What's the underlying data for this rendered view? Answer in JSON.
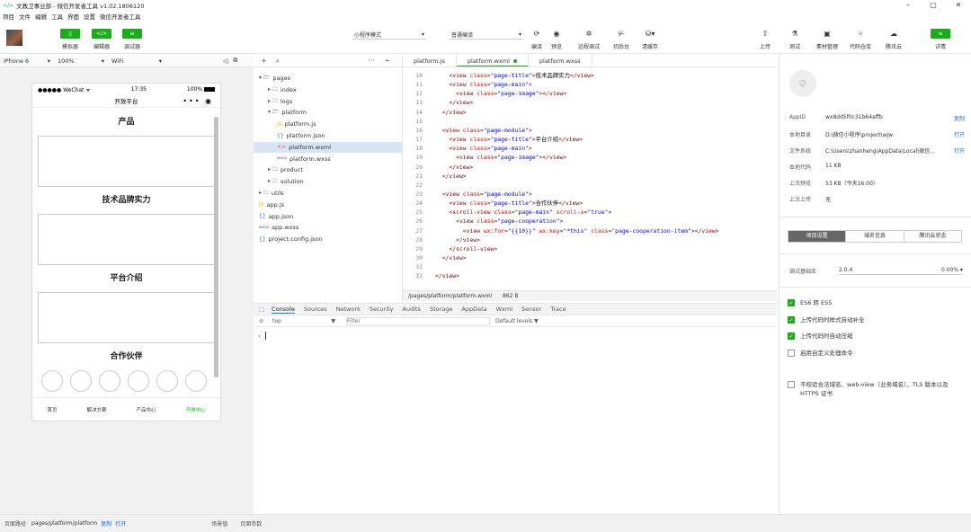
{
  "app": {
    "title": "文教卫事业部 - 微信开发者工具 v1.02.1806120"
  },
  "menu": [
    "项目",
    "文件",
    "编辑",
    "工具",
    "界面",
    "设置",
    "微信开发者工具"
  ],
  "toolbar": {
    "left_buttons": [
      {
        "label": "模拟器",
        "icon": "phone-icon",
        "glyph": "▯"
      },
      {
        "label": "编辑器",
        "icon": "code-icon",
        "glyph": "</>"
      },
      {
        "label": "调试器",
        "icon": "debug-icon",
        "glyph": "≡"
      }
    ],
    "mode_select": "小程序模式",
    "compile_select": "普通编译",
    "center_actions": [
      {
        "label": "编译",
        "glyph": "⟳"
      },
      {
        "label": "预览",
        "glyph": "◉"
      },
      {
        "label": "远程调试",
        "glyph": "✲"
      },
      {
        "label": "切后台",
        "glyph": "⊬"
      },
      {
        "label": "清缓存",
        "glyph": "⛁▾"
      }
    ],
    "right_actions": [
      {
        "label": "上传",
        "glyph": "⇧"
      },
      {
        "label": "测试",
        "glyph": "⚗"
      },
      {
        "label": "素材管理",
        "glyph": "▣"
      },
      {
        "label": "代码仓库",
        "glyph": "⑂"
      },
      {
        "label": "腾讯云",
        "glyph": "☁"
      }
    ],
    "details": {
      "label": "详情",
      "glyph": "≡"
    }
  },
  "device": {
    "model": "iPhone 6",
    "zoom": "100%",
    "network": "WiFi"
  },
  "phone": {
    "carrier": "●●●●● WeChat ᯤ",
    "time": "17:35",
    "battery": "100%",
    "nav_title": "开放平台",
    "capsule": "••• ◉",
    "modules": [
      {
        "title": "产品"
      },
      {
        "title": "技术品牌实力"
      },
      {
        "title": "平台介绍"
      },
      {
        "title": "合作伙伴"
      }
    ],
    "tabs": [
      {
        "label": "首页",
        "active": false
      },
      {
        "label": "解决方案",
        "active": false
      },
      {
        "label": "产品中心",
        "active": false
      },
      {
        "label": "开放中心",
        "active": true
      }
    ]
  },
  "filetree": {
    "items": [
      {
        "label": "pages",
        "indent": 0,
        "ic": "▾ 🗁",
        "icon": "folder-open-icon"
      },
      {
        "label": "index",
        "indent": 1,
        "ic": "▸ 🗀",
        "icon": "folder-icon"
      },
      {
        "label": "logs",
        "indent": 1,
        "ic": "▸ 🗀",
        "icon": "folder-icon"
      },
      {
        "label": "platform",
        "indent": 1,
        "ic": "▾ 🗁",
        "icon": "folder-open-icon"
      },
      {
        "label": "platform.js",
        "indent": 2,
        "ic": "JS",
        "icon": "js-file-icon"
      },
      {
        "label": "platform.json",
        "indent": 2,
        "ic": "{}",
        "icon": "json-file-icon"
      },
      {
        "label": "platform.wxml",
        "indent": 2,
        "ic": "<>",
        "icon": "wxml-file-icon",
        "active": true
      },
      {
        "label": "platform.wxss",
        "indent": 2,
        "ic": "wxss",
        "icon": "wxss-file-icon"
      },
      {
        "label": "product",
        "indent": 1,
        "ic": "▸ 🗀",
        "icon": "folder-icon"
      },
      {
        "label": "solution",
        "indent": 1,
        "ic": "▸ 🗀",
        "icon": "folder-icon"
      },
      {
        "label": "utils",
        "indent": 0,
        "ic": "▸ 🗀",
        "icon": "folder-icon"
      },
      {
        "label": "app.js",
        "indent": 0,
        "ic": "JS",
        "icon": "js-file-icon"
      },
      {
        "label": "app.json",
        "indent": 0,
        "ic": "{}",
        "icon": "json-file-icon"
      },
      {
        "label": "app.wxss",
        "indent": 0,
        "ic": "wxss",
        "icon": "wxss-file-icon"
      },
      {
        "label": "project.config.json",
        "indent": 0,
        "ic": "{}",
        "icon": "json-file-icon"
      }
    ]
  },
  "editor": {
    "tabs": [
      {
        "label": "platform.js",
        "active": false
      },
      {
        "label": "platform.wxml",
        "active": true
      },
      {
        "label": "platform.wxss",
        "active": false
      }
    ],
    "lines": [
      {
        "n": "10",
        "i": "    ",
        "c": "page-title",
        "text": "技术品牌实力",
        "k": "t"
      },
      {
        "n": "11",
        "i": "    ",
        "c": "page-main",
        "k": "o"
      },
      {
        "n": "12",
        "i": "      ",
        "c": "page-image",
        "k": "s"
      },
      {
        "n": "13",
        "i": "    ",
        "k": "e"
      },
      {
        "n": "14",
        "i": "  ",
        "k": "e"
      },
      {
        "n": "15",
        "i": "",
        "k": "b"
      },
      {
        "n": "16",
        "i": "  ",
        "c": "page-module",
        "k": "o"
      },
      {
        "n": "17",
        "i": "    ",
        "c": "page-title",
        "text": "平台介绍",
        "k": "t"
      },
      {
        "n": "18",
        "i": "    ",
        "c": "page-main",
        "k": "o"
      },
      {
        "n": "19",
        "i": "      ",
        "c": "page-image",
        "k": "s"
      },
      {
        "n": "20",
        "i": "    ",
        "k": "e"
      },
      {
        "n": "21",
        "i": "  ",
        "k": "e"
      },
      {
        "n": "22",
        "i": "",
        "k": "b"
      },
      {
        "n": "23",
        "i": "  ",
        "c": "page-module",
        "k": "o"
      },
      {
        "n": "24",
        "i": "    ",
        "c": "page-title",
        "text": "合作伙伴",
        "k": "t"
      },
      {
        "n": "25",
        "i": "    ",
        "k": "sv"
      },
      {
        "n": "26",
        "i": "      ",
        "c": "page-cooperation",
        "k": "o"
      },
      {
        "n": "27",
        "i": "        ",
        "k": "for"
      },
      {
        "n": "28",
        "i": "      ",
        "k": "e"
      },
      {
        "n": "29",
        "i": "    ",
        "k": "se"
      },
      {
        "n": "30",
        "i": "  ",
        "k": "e"
      },
      {
        "n": "31",
        "i": "",
        "k": "b"
      },
      {
        "n": "32",
        "i": "",
        "k": "e"
      }
    ],
    "status_path": "/pages/platform/platform.wxml",
    "status_size": "862 B"
  },
  "devtools": {
    "tabs": [
      "Console",
      "Sources",
      "Network",
      "Security",
      "Audits",
      "Storage",
      "AppData",
      "Wxml",
      "Sensor",
      "Trace"
    ],
    "context": "top",
    "filter_placeholder": "Filter",
    "levels": "Default levels ▼"
  },
  "details": {
    "info": [
      {
        "k": "AppID",
        "v": "wx8dd5f0c31b64affb",
        "a": "复制"
      },
      {
        "k": "本地目录",
        "v": "D:\\微信小程序\\project\\wjw",
        "a": "打开"
      },
      {
        "k": "文件系统",
        "v": "C:\\Users\\zhanheng\\AppData\\Local\\微信...",
        "a": "打开"
      },
      {
        "k": "本地代码",
        "v": "11 KB",
        "a": ""
      },
      {
        "k": "上次预览",
        "v": "53 KB（今天16:00）",
        "a": ""
      },
      {
        "k": "上次上传",
        "v": "无",
        "a": ""
      }
    ],
    "tabs": [
      {
        "label": "项目设置",
        "active": true
      },
      {
        "label": "域名信息",
        "active": false
      },
      {
        "label": "腾讯云状态",
        "active": false
      }
    ],
    "lib_label": "调试基础库",
    "lib_version": "2.0.4",
    "lib_percent": "0.00% ▾",
    "options": [
      {
        "label": "ES6 转 ES5",
        "on": true
      },
      {
        "label": "上传代码时样式自动补全",
        "on": true
      },
      {
        "label": "上传代码时自动压缩",
        "on": true
      },
      {
        "label": "启用自定义处理命令",
        "on": false
      },
      {
        "label": "不校验合法域名、web-view（业务域名）、TLS 版本以及 HTTPS 证书",
        "on": false
      }
    ]
  },
  "bottombar": {
    "path_label": "页面路径",
    "path": "pages/platform/platform",
    "copy": "复制",
    "open": "打开",
    "scene": "场景值",
    "params": "页面参数"
  }
}
